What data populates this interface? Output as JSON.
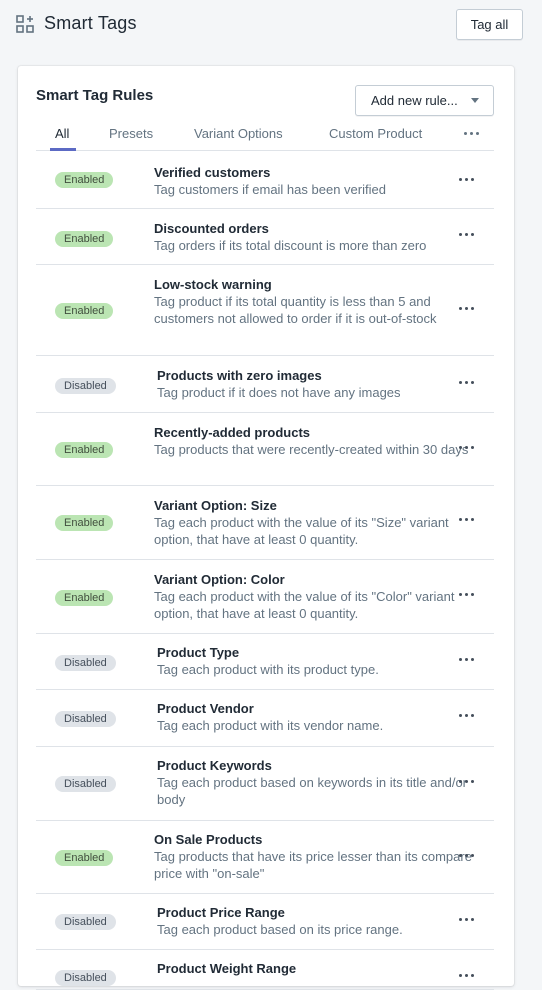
{
  "header": {
    "title": "Smart Tags",
    "tag_all_label": "Tag all"
  },
  "card": {
    "title": "Smart Tag Rules",
    "add_rule_label": "Add new rule..."
  },
  "tabs": [
    {
      "label": "All",
      "active": true
    },
    {
      "label": "Presets",
      "active": false
    },
    {
      "label": "Variant Options",
      "active": false
    },
    {
      "label": "Custom Product",
      "active": false
    }
  ],
  "rules": [
    {
      "status": "Enabled",
      "name": "Verified customers",
      "desc": "Tag customers if email has been verified"
    },
    {
      "status": "Enabled",
      "name": "Discounted orders",
      "desc": "Tag orders if its total discount is more than zero"
    },
    {
      "status": "Enabled",
      "name": "Low-stock warning",
      "desc": "Tag product if its total quantity is less than 5 and customers not allowed to order if it is out-of-stock"
    },
    {
      "status": "Disabled",
      "name": "Products with zero images",
      "desc": "Tag product if it does not have any images"
    },
    {
      "status": "Enabled",
      "name": "Recently-added products",
      "desc": "Tag products that were recently-created within 30 days"
    },
    {
      "status": "Enabled",
      "name": "Variant Option: Size",
      "desc": "Tag each product with the value of its \"Size\" variant option, that have at least 0 quantity."
    },
    {
      "status": "Enabled",
      "name": "Variant Option: Color",
      "desc": "Tag each product with the value of its \"Color\" variant option, that have at least 0 quantity."
    },
    {
      "status": "Disabled",
      "name": "Product Type",
      "desc": "Tag each product with its product type."
    },
    {
      "status": "Disabled",
      "name": "Product Vendor",
      "desc": "Tag each product with its vendor name."
    },
    {
      "status": "Disabled",
      "name": "Product Keywords",
      "desc": "Tag each product based on keywords in its title and/or body"
    },
    {
      "status": "Enabled",
      "name": "On Sale Products",
      "desc": "Tag products that have its price lesser than its compare price with \"on-sale\""
    },
    {
      "status": "Disabled",
      "name": "Product Price Range",
      "desc": "Tag each product based on its price range."
    },
    {
      "status": "Disabled",
      "name": "Product Weight Range",
      "desc": ""
    }
  ]
}
